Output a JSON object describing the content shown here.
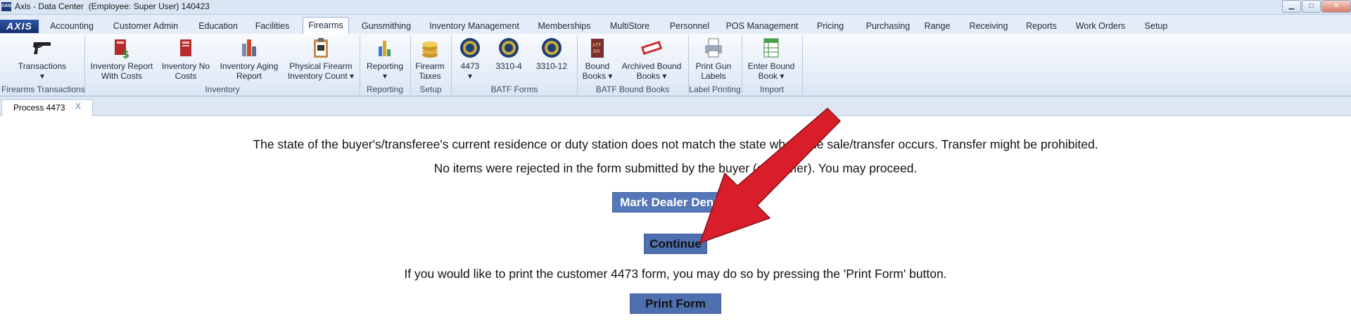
{
  "window": {
    "title": "Axis - Data Center  (Employee: Super User) 140423",
    "app_icon_text": "AXIS"
  },
  "logo": "AXIS",
  "menu_tabs": [
    "Accounting",
    "Customer Admin",
    "Education",
    "Facilities",
    "Firearms",
    "Gunsmithing",
    "Inventory Management",
    "Memberships",
    "MultiStore",
    "Personnel",
    "POS Management",
    "Pricing",
    "Purchasing",
    "Range",
    "Receiving",
    "Reports",
    "Work Orders",
    "Setup"
  ],
  "active_tab": "Firearms",
  "ribbon": {
    "buttons": [
      {
        "label1": "Transactions",
        "label2": "▾",
        "icon": "pistol-icon"
      },
      {
        "label1": "Inventory Report",
        "label2": "With Costs",
        "icon": "inventory-costs-icon"
      },
      {
        "label1": "Inventory No",
        "label2": "Costs",
        "icon": "inventory-no-costs-icon"
      },
      {
        "label1": "Inventory Aging",
        "label2": "Report",
        "icon": "aging-report-icon"
      },
      {
        "label1": "Physical Firearm",
        "label2": "Inventory Count ▾",
        "icon": "clipboard-icon"
      },
      {
        "label1": "Reporting",
        "label2": "▾",
        "icon": "bar-chart-icon"
      },
      {
        "label1": "Firearm",
        "label2": "Taxes",
        "icon": "coins-icon"
      },
      {
        "label1": "4473",
        "label2": "▾",
        "icon": "atf-seal-icon"
      },
      {
        "label1": "3310-4",
        "label2": "",
        "icon": "atf-seal-icon"
      },
      {
        "label1": "3310-12",
        "label2": "",
        "icon": "atf-seal-icon"
      },
      {
        "label1": "Bound",
        "label2": "Books ▾",
        "icon": "bound-book-icon"
      },
      {
        "label1": "Archived Bound",
        "label2": "Books ▾",
        "icon": "archived-stamp-icon"
      },
      {
        "label1": "Print Gun",
        "label2": "Labels",
        "icon": "printer-icon"
      },
      {
        "label1": "Enter Bound",
        "label2": "Book ▾",
        "icon": "spreadsheet-icon"
      }
    ],
    "groups": [
      "Firearms Transactions",
      "Inventory",
      "Reporting",
      "Setup",
      "BATF Forms",
      "BATF Bound Books",
      "Label Printing",
      "Import"
    ]
  },
  "document_tab": {
    "label": "Process 4473",
    "close": "X"
  },
  "content": {
    "message_state": "The state of the buyer's/transferee's current residence or duty station does not match the state where the sale/transfer occurs.  Transfer might be prohibited.",
    "message_items": "No items were rejected in the form submitted by the buyer (customer).  You may proceed.",
    "mark_denied_label": "Mark Dealer Denied",
    "continue_label": "Continue",
    "print_prompt": "If you would like to print the customer 4473 form, you may do so by pressing the 'Print Form' button.",
    "print_form_label": "Print Form"
  },
  "colors": {
    "arrow": "#d81e2a",
    "button": "#5577b8",
    "ribbon_bg": "#dbe6f4"
  }
}
